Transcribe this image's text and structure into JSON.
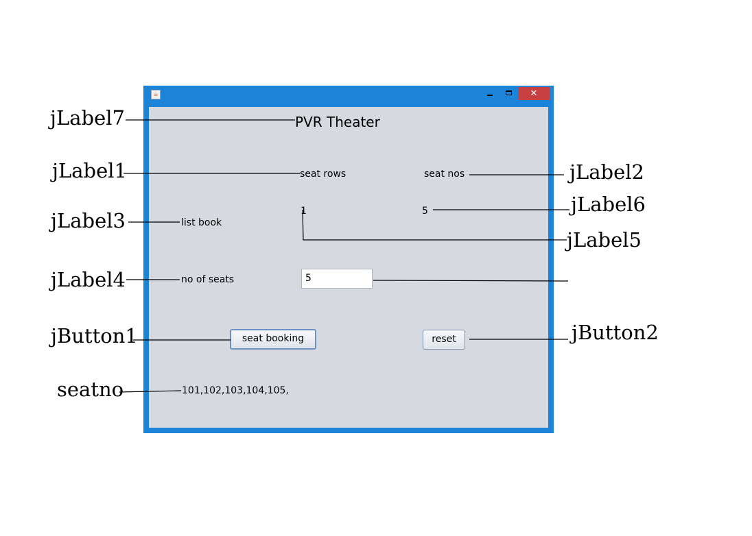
{
  "annotations": {
    "jlabel7": "jLabel7",
    "jlabel1": "jLabel1",
    "jlabel2": "jLabel2",
    "jlabel3": "jLabel3",
    "jlabel6": "jLabel6",
    "jlabel5": "jLabel5",
    "jlabel4": "jLabel4",
    "jbutton1": "jButton1",
    "jbutton2": "jButton2",
    "seatno": "seatno"
  },
  "window": {
    "app_icon": "java-cup-icon",
    "minimize_glyph": "",
    "maximize_glyph": "",
    "close_glyph": "✕",
    "titlebar_color": "#1c84d8",
    "close_color": "#c84040",
    "client_bg": "#d6d9e0"
  },
  "form": {
    "title": "PVR Theater",
    "seat_rows_label": "seat rows",
    "seat_nos_label": "seat nos",
    "list_book_label": "list book",
    "seat_rows_value": "1",
    "seat_nos_value": "5",
    "no_of_seats_label": "no of seats",
    "no_of_seats_value": "5",
    "seat_booking_button": "seat booking",
    "reset_button": "reset",
    "seatno_output": "101,102,103,104,105,"
  }
}
